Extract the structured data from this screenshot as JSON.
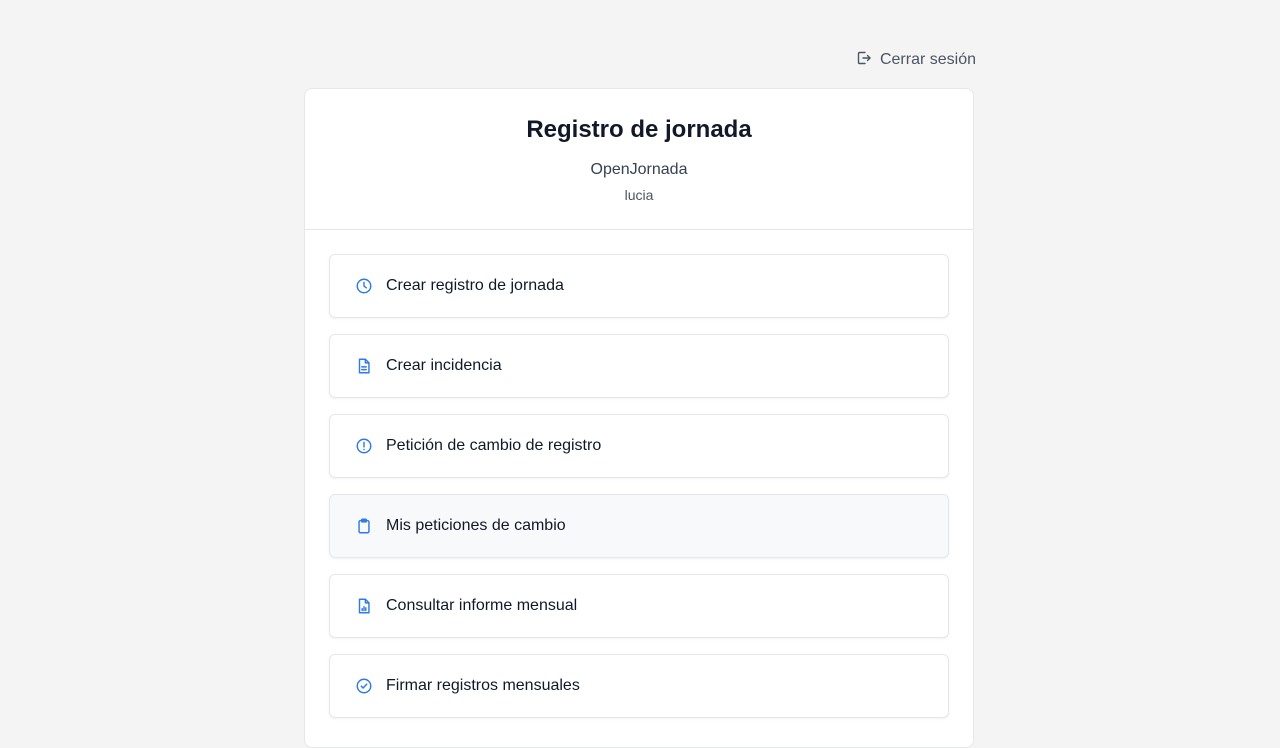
{
  "header": {
    "logout_label": "Cerrar sesión"
  },
  "card": {
    "title": "Registro de jornada",
    "company": "OpenJornada",
    "username": "lucia"
  },
  "menu": {
    "items": [
      {
        "label": "Crear registro de jornada",
        "icon": "clock-icon"
      },
      {
        "label": "Crear incidencia",
        "icon": "document-icon"
      },
      {
        "label": "Petición de cambio de registro",
        "icon": "alert-circle-icon"
      },
      {
        "label": "Mis peticiones de cambio",
        "icon": "clipboard-icon"
      },
      {
        "label": "Consultar informe mensual",
        "icon": "report-icon"
      },
      {
        "label": "Firmar registros mensuales",
        "icon": "check-circle-icon"
      }
    ]
  },
  "colors": {
    "accent": "#2f7ae5",
    "background": "#f4f4f5",
    "card": "#ffffff"
  }
}
